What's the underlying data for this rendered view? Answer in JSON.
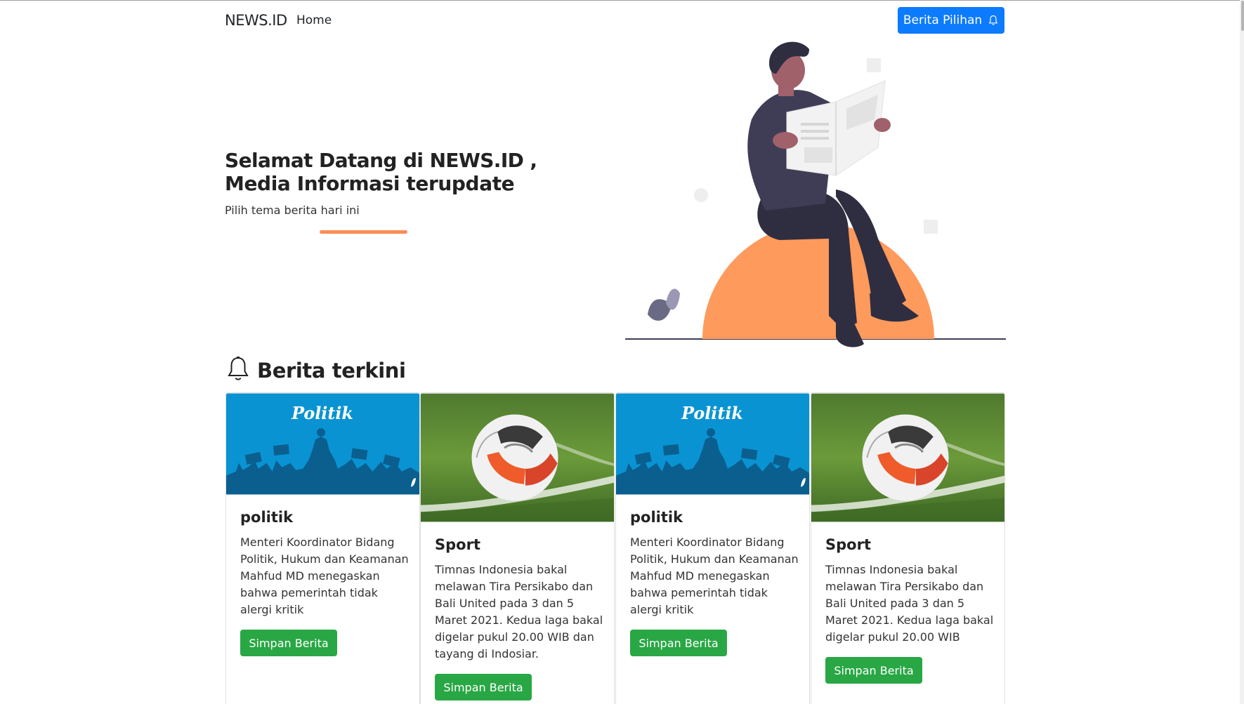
{
  "navbar": {
    "brand": "NEWS.ID",
    "home_label": "Home",
    "pilihan_label": "Berita Pilihan"
  },
  "hero": {
    "title": "Selamat Datang di NEWS.ID ,",
    "subtitle": "Media Informasi terupdate",
    "tagline": "Pilih tema berita hari ini"
  },
  "section": {
    "title": "Berita terkini"
  },
  "cards": [
    {
      "image_caption": "Politik",
      "title": "politik",
      "text": "Menteri Koordinator Bidang Politik, Hukum dan Keamanan Mahfud MD menegaskan bahwa pemerintah tidak alergi kritik",
      "button": "Simpan Berita"
    },
    {
      "title": "Sport",
      "text": "Timnas Indonesia bakal melawan Tira Persikabo dan Bali United pada 3 dan 5 Maret 2021. Kedua laga bakal digelar pukul 20.00 WIB dan tayang di Indosiar.",
      "button": "Simpan Berita"
    },
    {
      "image_caption": "Politik",
      "title": "politik",
      "text": "Menteri Koordinator Bidang Politik, Hukum dan Keamanan Mahfud MD menegaskan bahwa pemerintah tidak alergi kritik",
      "button": "Simpan Berita"
    },
    {
      "title": "Sport",
      "text": "Timnas Indonesia bakal melawan Tira Persikabo dan Bali United pada 3 dan 5 Maret 2021. Kedua laga bakal digelar pukul 20.00 WIB",
      "button": "Simpan Berita"
    }
  ],
  "colors": {
    "primary": "#0d7bfd",
    "success": "#29a745",
    "accent": "#fb8d54",
    "politik_bg": "#0a93d2",
    "politik_crowd": "#0a5f8f"
  },
  "icons": {
    "bell": "bell-icon",
    "politik_image": "politik-banner-image",
    "sport_image": "soccer-ball-image",
    "hero_image": "man-reading-newspaper-illustration"
  }
}
